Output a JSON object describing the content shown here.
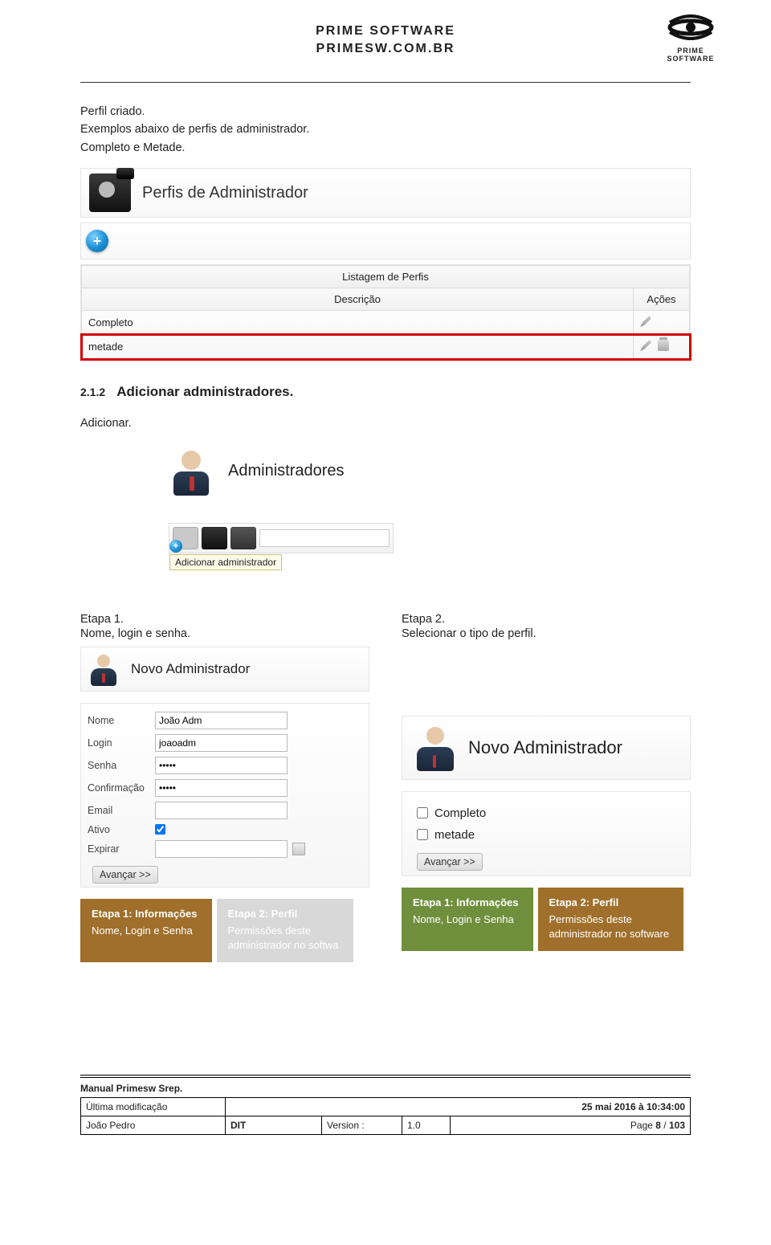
{
  "header": {
    "brand_line1": "PRIME SOFTWARE",
    "brand_line2": "PRIMESW.COM.BR",
    "logo_top": "PRIME",
    "logo_bottom": "SOFTWARE"
  },
  "intro": {
    "l1": "Perfil criado.",
    "l2": "Exemplos abaixo de perfis de administrador.",
    "l3": "Completo e Metade."
  },
  "screenshot1": {
    "title": "Perfis de Administrador",
    "table_title": "Listagem de Perfis",
    "col_desc": "Descrição",
    "col_actions": "Ações",
    "rows": [
      {
        "desc": "Completo"
      },
      {
        "desc": "metade"
      }
    ]
  },
  "section": {
    "num": "2.1.2",
    "title": "Adicionar administradores."
  },
  "adicionar_label": "Adicionar.",
  "admins": {
    "title": "Administradores",
    "tooltip": "Adicionar administrador"
  },
  "etapa1": {
    "h": "Etapa 1.",
    "sub": "Nome, login e senha.",
    "card_title": "Novo Administrador",
    "fields": {
      "nome_lbl": "Nome",
      "nome_val": "João Adm",
      "login_lbl": "Login",
      "login_val": "joaoadm",
      "senha_lbl": "Senha",
      "senha_val": "•••••",
      "conf_lbl": "Confirmação",
      "conf_val": "•••••",
      "email_lbl": "Email",
      "email_val": "",
      "ativo_lbl": "Ativo",
      "expirar_lbl": "Expirar",
      "expirar_val": ""
    },
    "avancar": "Avançar >>",
    "step1_t": "Etapa 1: Informações",
    "step1_s": "Nome, Login e Senha",
    "step2_t": "Etapa 2: Perfil",
    "step2_s": "Permissões deste",
    "step2_s2": "administrador no softwa"
  },
  "etapa2": {
    "h": "Etapa 2.",
    "sub": "Selecionar o tipo de perfil.",
    "card_title": "Novo Administrador",
    "opts": {
      "completo": "Completo",
      "metade": "metade"
    },
    "avancar": "Avançar >>",
    "step1_t": "Etapa 1: Informações",
    "step1_s": "Nome, Login e Senha",
    "step2_t": "Etapa 2: Perfil",
    "step2_s": "Permissões deste",
    "step2_s2": "administrador no software"
  },
  "footer": {
    "manual": "Manual Primesw Srep.",
    "row1_l": "Última modificação",
    "row1_r": "25 mai 2016 à 10:34:00",
    "row2_c1": "João Pedro",
    "row2_c2": "DIT",
    "row2_c3l": "Version :",
    "row2_c3v": "1.0",
    "row2_c4": "Page 8 / 103"
  }
}
